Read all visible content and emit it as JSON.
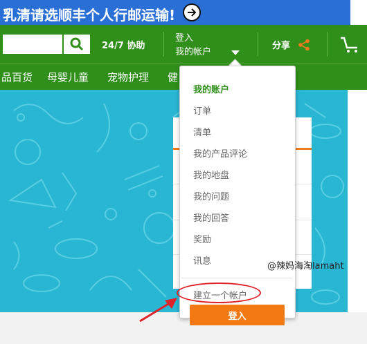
{
  "banner": {
    "text": "乳清请选顺丰个人行邮运输!"
  },
  "header": {
    "help": "24/7 协助",
    "login_line1": "登入",
    "login_line2": "我的帐户",
    "share": "分享"
  },
  "categories": [
    "品百货",
    "母婴儿童",
    "宠物护理",
    "健"
  ],
  "account_menu": {
    "items": [
      "我的账户",
      "订单",
      "清单",
      "我的产品评论",
      "我的地盘",
      "我的问题",
      "我的回答",
      "奖励",
      "讯息"
    ],
    "create_account": "建立一个帐户",
    "login_button": "登入"
  },
  "watermark": "@辣妈海淘lamaht",
  "colors": {
    "green": "#2f8f1a",
    "blue_banner": "#2a6fd6",
    "hero": "#29b6d3",
    "orange": "#f37a12",
    "annotation_red": "#e0212a"
  }
}
